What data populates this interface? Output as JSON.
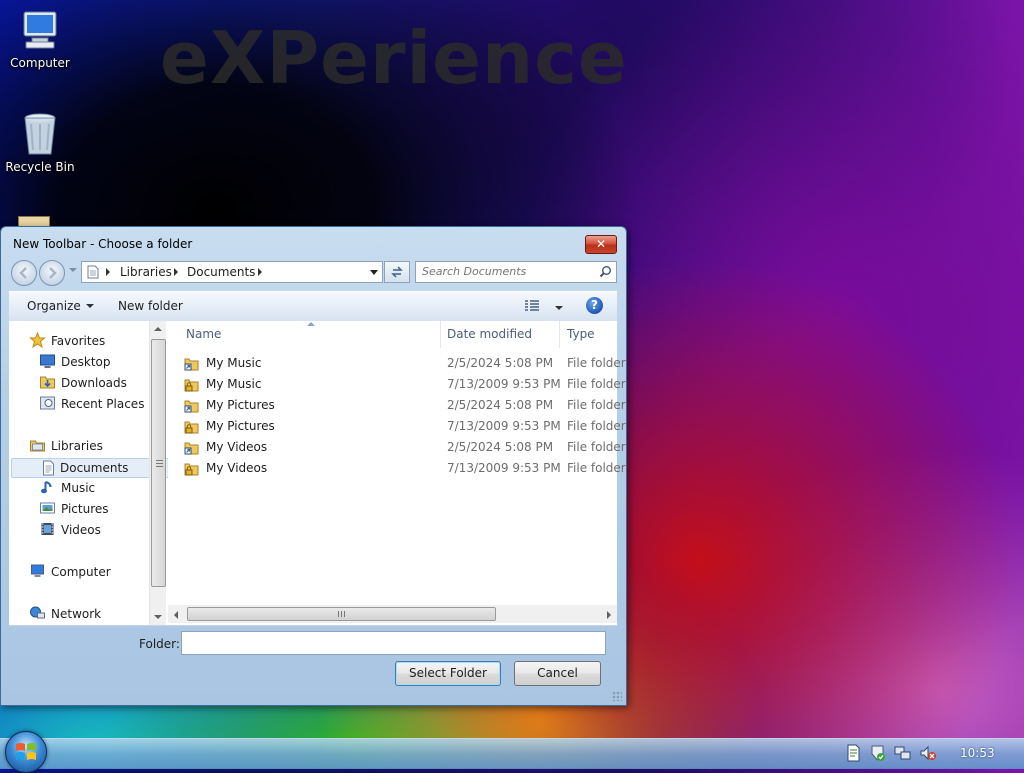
{
  "wallpaper": {
    "brand_text": "eXPerience"
  },
  "desktop": {
    "icons": [
      {
        "label": "Computer",
        "icon": "computer-icon"
      },
      {
        "label": "Recycle Bin",
        "icon": "recycle-bin-icon"
      }
    ]
  },
  "dialog": {
    "title": "New Toolbar - Choose a folder",
    "close_glyph": "✕",
    "breadcrumb": [
      "Libraries",
      "Documents"
    ],
    "search_placeholder": "Search Documents",
    "toolbar": {
      "organize_label": "Organize",
      "new_folder_label": "New folder"
    },
    "nav_pane": {
      "favorites": {
        "label": "Favorites",
        "items": [
          "Desktop",
          "Downloads",
          "Recent Places"
        ]
      },
      "libraries": {
        "label": "Libraries",
        "items": [
          "Documents",
          "Music",
          "Pictures",
          "Videos"
        ],
        "selected": "Documents"
      },
      "computer_label": "Computer",
      "network_label": "Network"
    },
    "columns": {
      "name": "Name",
      "date_modified": "Date modified",
      "type": "Type"
    },
    "rows": [
      {
        "name": "My Music",
        "date": "2/5/2024 5:08 PM",
        "type": "File folder",
        "icon": "shortcut-folder-icon"
      },
      {
        "name": "My Music",
        "date": "7/13/2009 9:53 PM",
        "type": "File folder",
        "icon": "locked-folder-icon"
      },
      {
        "name": "My Pictures",
        "date": "2/5/2024 5:08 PM",
        "type": "File folder",
        "icon": "shortcut-folder-icon"
      },
      {
        "name": "My Pictures",
        "date": "7/13/2009 9:53 PM",
        "type": "File folder",
        "icon": "locked-folder-icon"
      },
      {
        "name": "My Videos",
        "date": "2/5/2024 5:08 PM",
        "type": "File folder",
        "icon": "shortcut-folder-icon"
      },
      {
        "name": "My Videos",
        "date": "7/13/2009 9:53 PM",
        "type": "File folder",
        "icon": "locked-folder-icon"
      }
    ],
    "folder_label": "Folder:",
    "folder_value": "",
    "select_button": "Select Folder",
    "cancel_button": "Cancel"
  },
  "taskbar": {
    "clock": "10:53"
  },
  "colors": {
    "title_bar": "#b6cfe8",
    "close_button": "#c8442c",
    "selection": "#e4eef9",
    "taskbar": "#78aad7"
  }
}
